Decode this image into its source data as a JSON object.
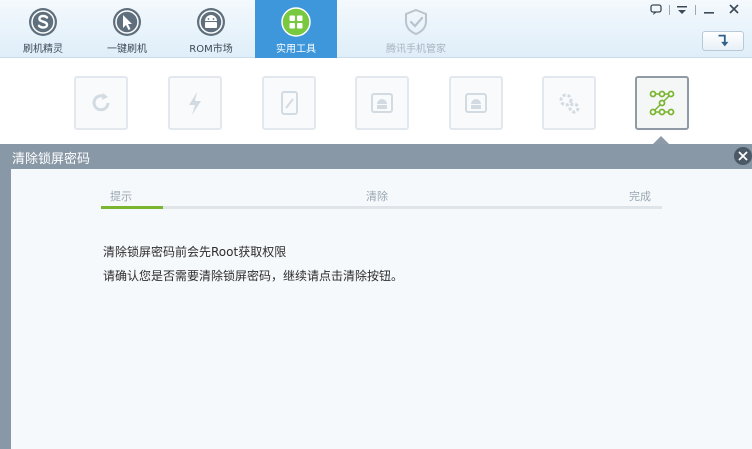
{
  "nav": {
    "items": [
      {
        "label": "刷机精灵",
        "icon": "s-logo-icon"
      },
      {
        "label": "一键刷机",
        "icon": "cursor-arrow-icon"
      },
      {
        "label": "ROM市场",
        "icon": "android-icon"
      },
      {
        "label": "实用工具",
        "icon": "grid-tools-icon",
        "active": true
      },
      {
        "label": "腾讯手机管家",
        "icon": "shield-check-icon",
        "disabled": true
      }
    ],
    "window_buttons": [
      "chat-icon",
      "dropdown-icon",
      "minimize-icon",
      "close-icon"
    ],
    "back_button_icon": "return-arrow-icon"
  },
  "tools": {
    "items": [
      {
        "icon": "refresh-icon"
      },
      {
        "icon": "lightning-icon"
      },
      {
        "icon": "phone-edit-icon"
      },
      {
        "icon": "android-box-icon"
      },
      {
        "icon": "android-box-icon"
      },
      {
        "icon": "gears-icon"
      },
      {
        "icon": "pattern-lock-icon",
        "active": true
      }
    ]
  },
  "dialog": {
    "title": "清除锁屏密码",
    "steps": [
      "提示",
      "清除",
      "完成"
    ],
    "progress": 0.11,
    "message_line1": "清除锁屏密码前会先Root获取权限",
    "message_line2": "请确认您是否需要清除锁屏密码，继续请点击清除按钮。"
  },
  "colors": {
    "accent": "#3f97db",
    "progress": "#7ab532",
    "dialog_header": "#8998a6"
  }
}
